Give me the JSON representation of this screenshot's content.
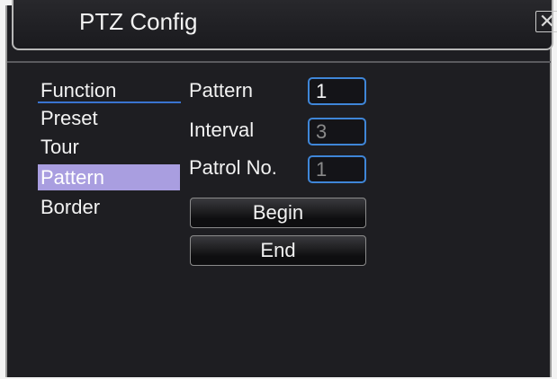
{
  "window": {
    "title": "PTZ Config",
    "close_symbol": "✕"
  },
  "menu": {
    "items": [
      {
        "label": "Function",
        "selected": false
      },
      {
        "label": "Preset",
        "selected": false
      },
      {
        "label": "Tour",
        "selected": false
      },
      {
        "label": "Pattern",
        "selected": true
      },
      {
        "label": "Border",
        "selected": false
      }
    ]
  },
  "form": {
    "pattern_label": "Pattern",
    "pattern_value": "1",
    "interval_label": "Interval",
    "interval_value": "3",
    "patrol_label": "Patrol No.",
    "patrol_value": "1"
  },
  "buttons": {
    "begin_label": "Begin",
    "end_label": "End"
  },
  "colors": {
    "selection": "#a99ee0",
    "field_border": "#3f86d8",
    "background": "#1e1e22"
  }
}
